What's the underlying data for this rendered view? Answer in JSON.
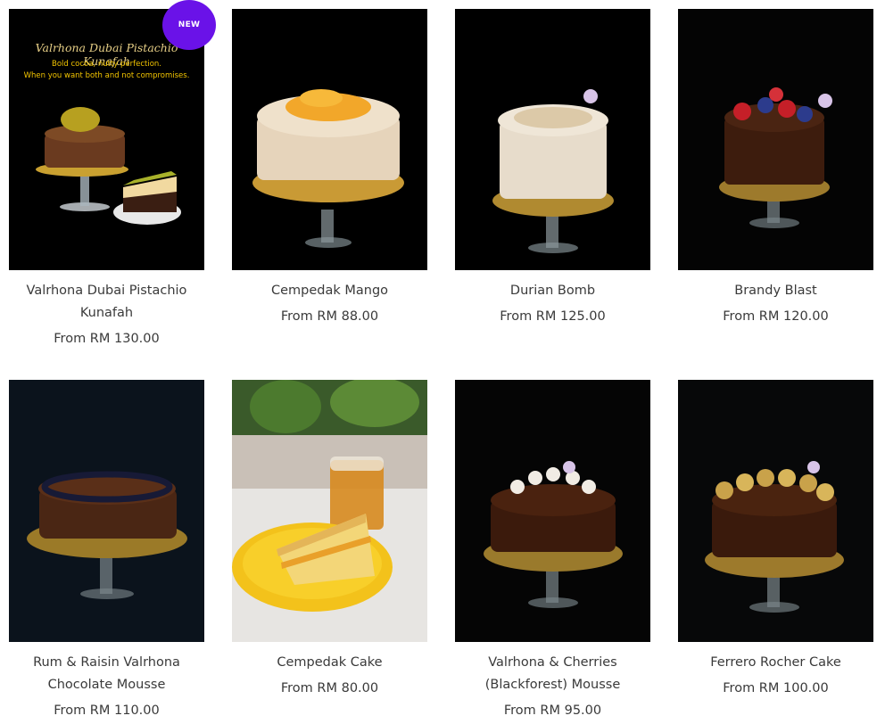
{
  "badge": {
    "label": "NEW"
  },
  "products": [
    {
      "name": "Valrhona Dubai Pistachio Kunafah",
      "price": "From RM 130.00",
      "poster_title": "Valrhona Dubai Pistachio Kunafah",
      "poster_subtitle_line1": "Bold cocoa, nutty perfection.",
      "poster_subtitle_line2": "When you want both and not compromises."
    },
    {
      "name": "Cempedak Mango",
      "price": "From RM 88.00"
    },
    {
      "name": "Durian Bomb",
      "price": "From RM 125.00"
    },
    {
      "name": "Brandy Blast",
      "price": "From RM 120.00"
    },
    {
      "name": "Rum & Raisin Valrhona Chocolate Mousse",
      "price": "From RM 110.00"
    },
    {
      "name": "Cempedak Cake",
      "price": "From RM 80.00"
    },
    {
      "name": "Valrhona & Cherries (Blackforest) Mousse",
      "price": "From RM 95.00"
    },
    {
      "name": "Ferrero Rocher Cake",
      "price": "From RM 100.00"
    }
  ]
}
